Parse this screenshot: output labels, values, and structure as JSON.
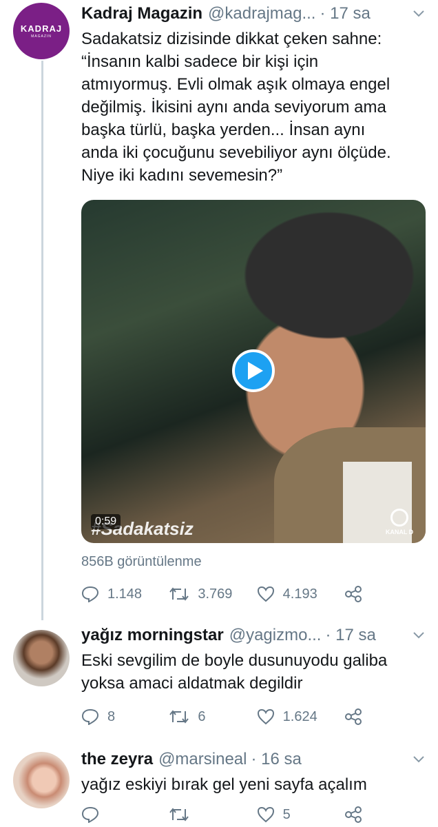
{
  "tweets": [
    {
      "name": "Kadraj Magazin",
      "handle": "@kadrajmag...",
      "time": "· 17 sa",
      "avatar_text": "KADRAJ",
      "avatar_subtext": "MAGAZIN",
      "text_lines": [
        "Sadakatsiz dizisinde dikkat çeken sahne:",
        "“İnsanın kalbi sadece bir kişi için",
        "atmıyormuş. Evli olmak aşık olmaya engel",
        "değilmiş. İkisini aynı anda seviyorum ama",
        "başka türlü, başka yerden... İnsan aynı",
        "anda iki çocuğunu sevebiliyor aynı ölçüde.",
        "Niye iki kadını sevemesin?”"
      ],
      "video": {
        "duration": "0:59",
        "overlay_text": "#Sadakatsiz",
        "channel": "KANAL D"
      },
      "views": "856B görüntülenme",
      "replies": "1.148",
      "retweets": "3.769",
      "likes": "4.193"
    },
    {
      "name": "yağız morningstar",
      "handle": "@yagizmo...",
      "time": "· 17 sa",
      "text_lines": [
        "Eski sevgilim de boyle dusunuyodu galiba",
        "yoksa amaci aldatmak degildir"
      ],
      "replies": "8",
      "retweets": "6",
      "likes": "1.624"
    },
    {
      "name": "the zeyra",
      "handle": "@marsineal",
      "time": "· 16 sa",
      "text_lines": [
        "yağız eskiyi bırak gel yeni sayfa açalım"
      ],
      "replies": "",
      "retweets": "",
      "likes": "5"
    }
  ],
  "colors": {
    "accent": "#1da1f2",
    "secondary_text": "#657786",
    "thread_line": "#ccd6dd"
  }
}
